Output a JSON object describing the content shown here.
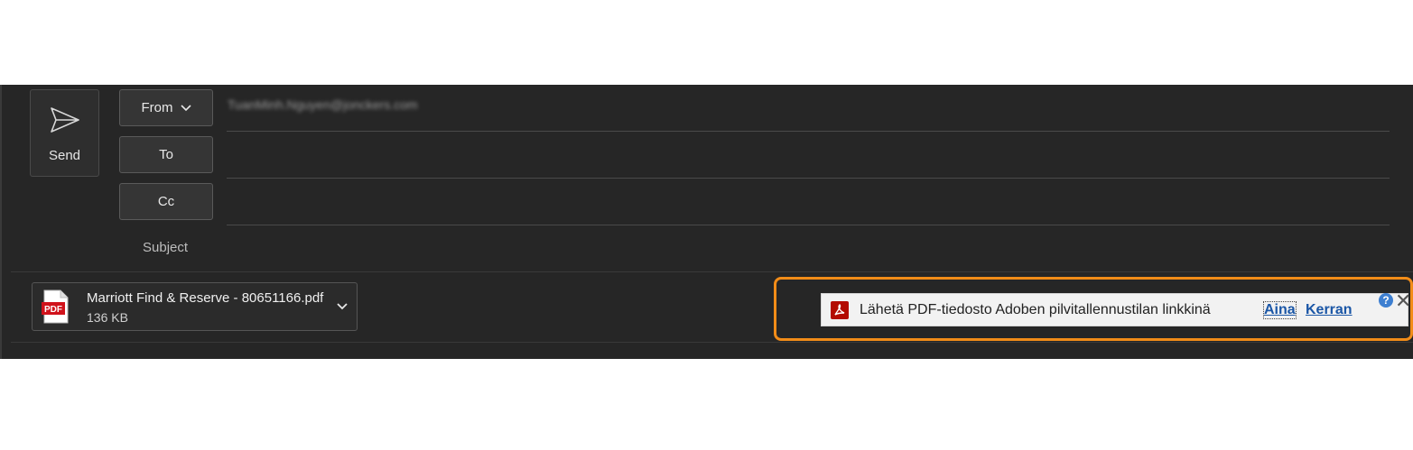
{
  "toolbar": {
    "send_label_prefix": "",
    "send_label": "Send"
  },
  "fields": {
    "from": {
      "label": "From",
      "value": "TuanMinh.Nguyen@jonckers.com"
    },
    "to": {
      "label": "To",
      "value": ""
    },
    "cc": {
      "label": "Cc",
      "value": ""
    },
    "subject": {
      "label": "Subject",
      "value": ""
    }
  },
  "attachment": {
    "name": "Marriott Find & Reserve - 80651166.pdf",
    "size": "136 KB",
    "icon": "pdf-file-icon"
  },
  "adobe_bar": {
    "text": "Lähetä PDF-tiedosto Adoben pilvitallennustilan linkkinä",
    "always_label": "Aina",
    "once_label": "Kerran",
    "help_glyph": "?",
    "close_glyph": "✕"
  },
  "colors": {
    "background": "#262626",
    "highlight": "#f28c18",
    "link": "#1a56a6",
    "pdf_red": "#d0121b"
  }
}
